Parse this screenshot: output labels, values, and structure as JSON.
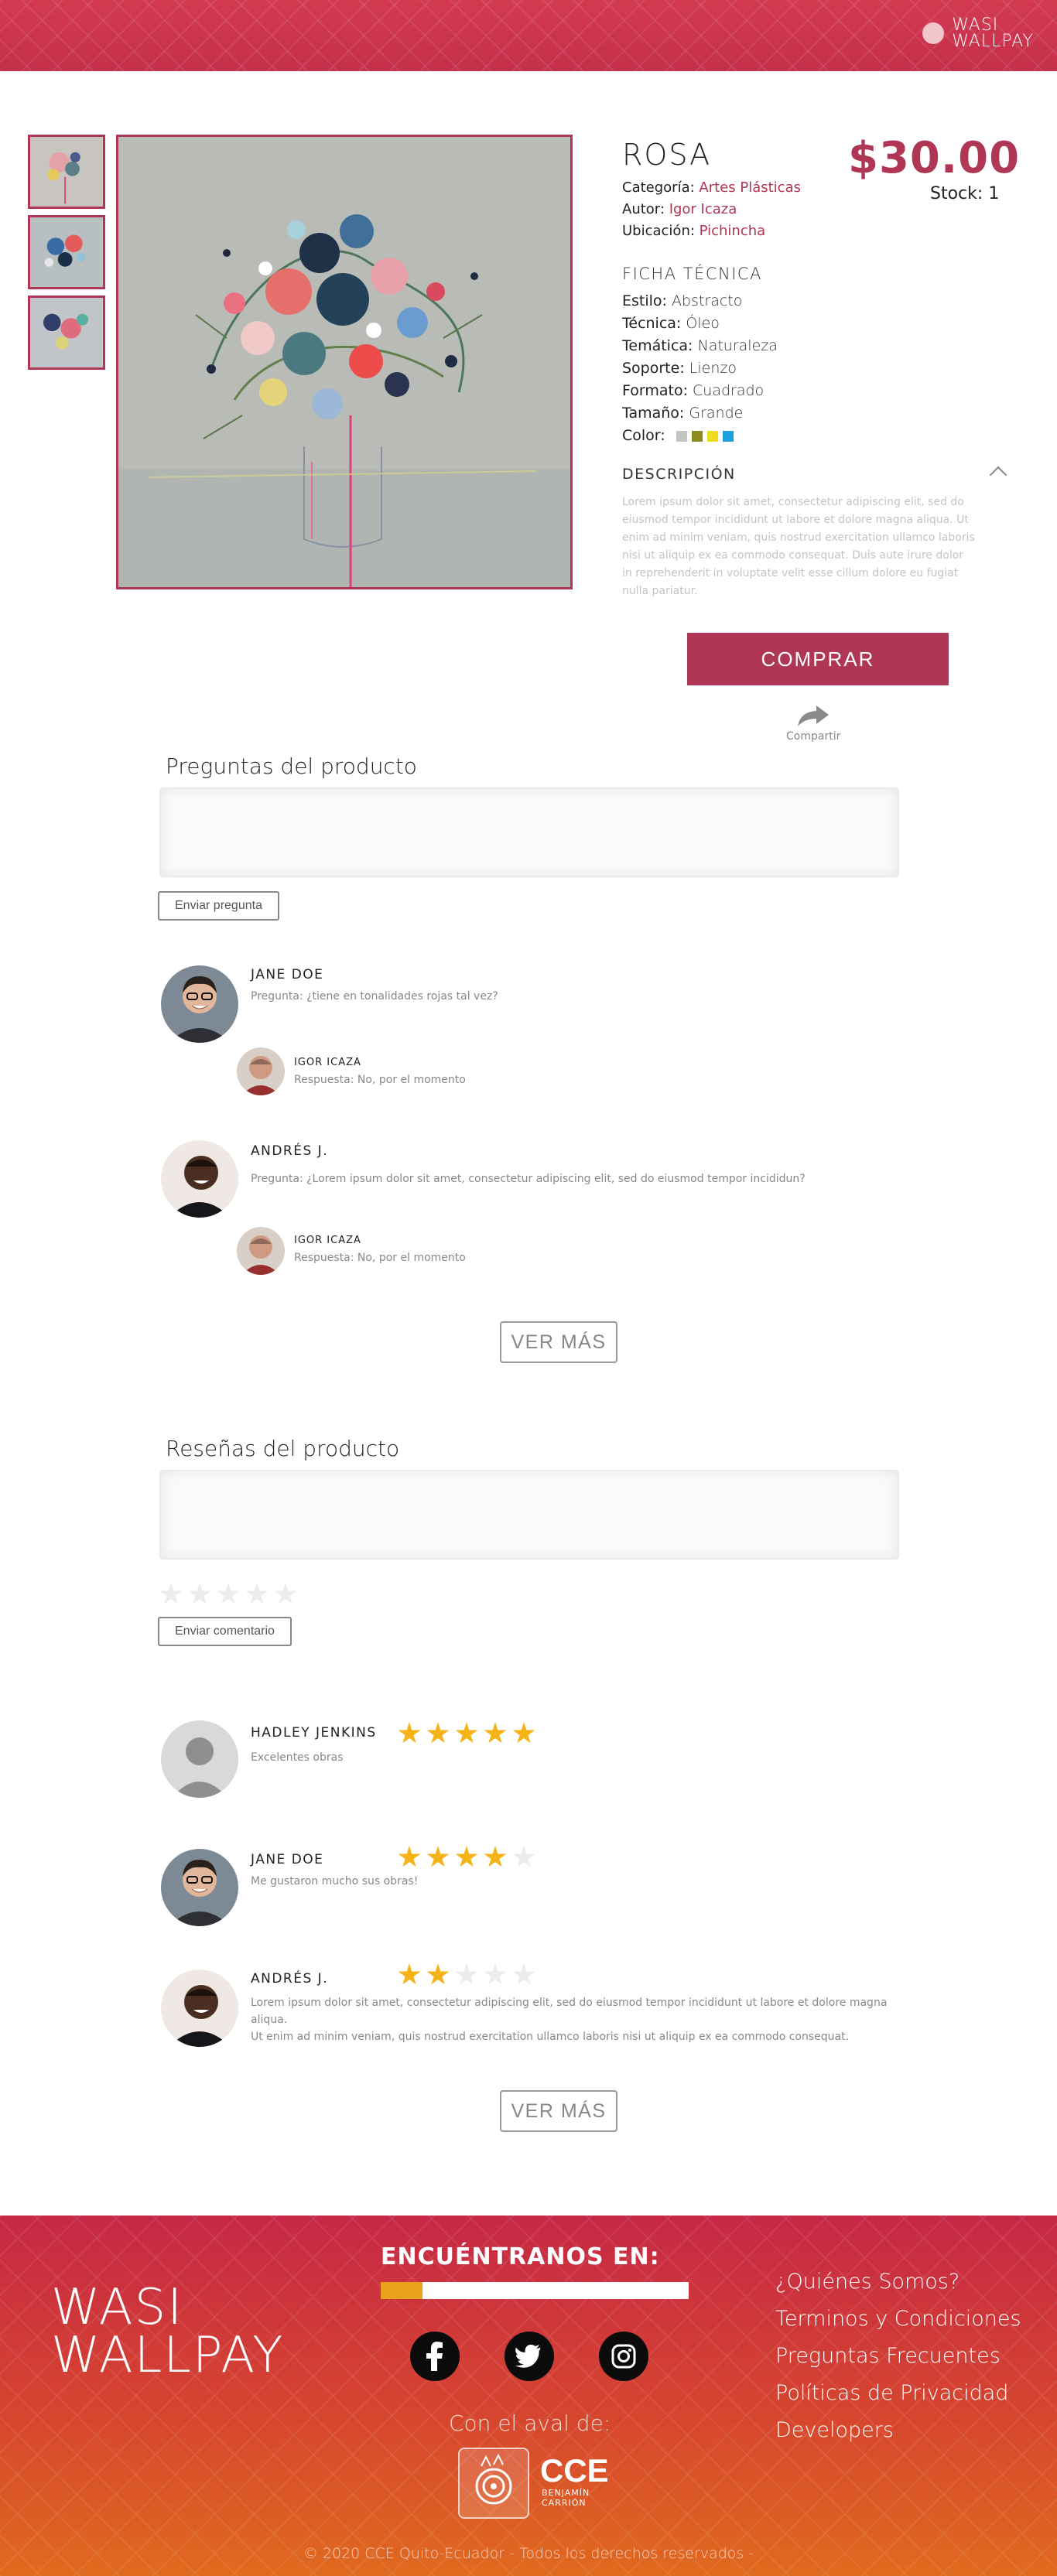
{
  "header": {
    "logo_line1": "WASI",
    "logo_line2": "WALLPAY"
  },
  "product": {
    "title": "ROSA",
    "price": "$30.00",
    "stock_label": "Stock:",
    "stock_value": "1",
    "category_label": "Categoría:",
    "category_value": "Artes Plásticas",
    "author_label": "Autor:",
    "author_value": "Igor Icaza",
    "location_label": "Ubicación:",
    "location_value": "Pichincha",
    "ficha_title": "FICHA TÉCNICA",
    "specs": [
      {
        "label": "Estilo:",
        "value": "Abstracto"
      },
      {
        "label": "Técnica:",
        "value": "Óleo"
      },
      {
        "label": "Temática:",
        "value": "Naturaleza"
      },
      {
        "label": "Soporte:",
        "value": "Lienzo"
      },
      {
        "label": "Formato:",
        "value": "Cuadrado"
      },
      {
        "label": "Tamaño:",
        "value": "Grande"
      }
    ],
    "color_label": "Color:",
    "colors": [
      "#c4c4c4",
      "#8c8c1c",
      "#f0dc1e",
      "#1ea0dc"
    ],
    "desc_title": "DESCRIPCIÓN",
    "desc_text": "Lorem ipsum dolor sit amet, consectetur adipiscing elit, sed do eiusmod tempor incididunt ut labore et dolore magna aliqua. Ut enim ad minim veniam, quis nostrud exercitation ullamco laboris nisi ut aliquip ex ea commodo consequat. Duis aute irure dolor in reprehenderit in voluptate velit esse cillum dolore eu fugiat nulla pariatur.",
    "buy_label": "COMPRAR",
    "share_label": "Compartir"
  },
  "questions": {
    "title": "Preguntas del producto",
    "send_label": "Enviar pregunta",
    "items": [
      {
        "name": "JANE DOE",
        "text": "Pregunta: ¿tiene en tonalidades rojas tal vez?",
        "answer_name": "IGOR ICAZA",
        "answer_text": "Respuesta: No, por el momento"
      },
      {
        "name": "ANDRÉS J.",
        "text": "Pregunta: ¿Lorem ipsum dolor sit amet, consectetur adipiscing elit, sed do eiusmod tempor incididun?",
        "answer_name": "IGOR ICAZA",
        "answer_text": "Respuesta: No, por el momento"
      }
    ],
    "more_label": "VER MÁS"
  },
  "reviews": {
    "title": "Reseñas del producto",
    "send_label": "Enviar comentario",
    "input_rating": 0,
    "items": [
      {
        "name": "HADLEY JENKINS",
        "rating": 5,
        "text": "Excelentes obras"
      },
      {
        "name": "JANE DOE",
        "rating": 4,
        "text": "Me gustaron mucho sus obras!"
      },
      {
        "name": "ANDRÉS J.",
        "rating": 2,
        "text_line1": "Lorem ipsum dolor sit amet, consectetur adipiscing elit, sed do eiusmod tempor incididunt ut labore et dolore magna aliqua.",
        "text_line2": "Ut enim ad minim veniam, quis nostrud exercitation ullamco laboris nisi ut aliquip ex ea commodo consequat."
      }
    ],
    "more_label": "VER MÁS"
  },
  "footer": {
    "logo_line1": "WASI",
    "logo_line2": "WALLPAY",
    "find_title": "ENCUÉNTRANOS EN:",
    "aval_label": "Con el aval de:",
    "cce_label": "CCE",
    "cce_sub1": "BENJAMÍN",
    "cce_sub2": "CARRIÓN",
    "links": [
      "¿Quiénes Somos?",
      "Terminos y Condiciones",
      "Preguntas Frecuentes",
      "Políticas de Privacidad",
      "Developers"
    ],
    "copyright": "© 2020 CCE Quito-Ecuador - Todos los derechos reservados -"
  },
  "icons": {
    "share": "share-icon",
    "chevron": "chevron-up-icon",
    "facebook": "facebook-icon",
    "twitter": "twitter-icon",
    "instagram": "instagram-icon"
  },
  "colors": {
    "brand": "#b03655",
    "header": "#c42f4a",
    "star": "#f4b416"
  }
}
